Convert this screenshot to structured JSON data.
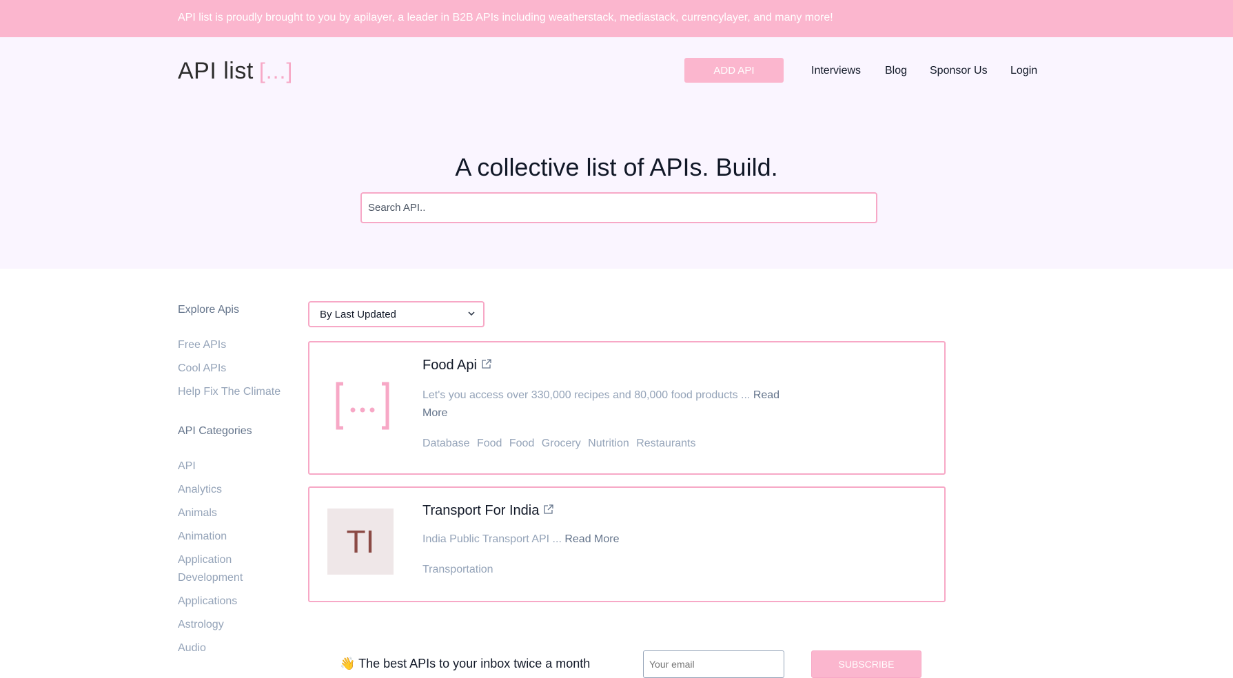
{
  "banner": {
    "text": "API list is proudly brought to you by apilayer, a leader in B2B APIs including weatherstack, mediastack, currencylayer, and many more!"
  },
  "header": {
    "logo_text": "API list",
    "logo_brackets": "[...]",
    "add_api_label": "ADD API",
    "nav": [
      "Interviews",
      "Blog",
      "Sponsor Us",
      "Login"
    ]
  },
  "hero": {
    "title": "A collective list of APIs. Build.",
    "search_placeholder": "Search API.."
  },
  "sidebar": {
    "explore_heading": "Explore Apis",
    "explore_items": [
      "Free APIs",
      "Cool APIs",
      "Help Fix The Climate"
    ],
    "categories_heading": "API Categories",
    "categories": [
      "API",
      "Analytics",
      "Animals",
      "Animation",
      "Application Development",
      "Applications",
      "Astrology",
      "Audio"
    ]
  },
  "sort": {
    "selected": "By Last Updated"
  },
  "cards": [
    {
      "title": "Food Api",
      "description": "Let's you access over 330,000 recipes and 80,000 food products ...",
      "read_more": "Read More",
      "tags": [
        "Database",
        "Food",
        "Food",
        "Grocery",
        "Nutrition",
        "Restaurants"
      ],
      "logo": "bracket-logo"
    },
    {
      "title": "Transport For India",
      "description": "India Public Transport API ...",
      "read_more": "Read More",
      "tags": [
        "Transportation"
      ],
      "initials": "TI"
    }
  ],
  "newsletter": {
    "text": "The best APIs to your inbox twice a month",
    "email_placeholder": "Your email",
    "subscribe_label": "SUBSCRIBE"
  },
  "colors": {
    "accent": "#fbb6ce",
    "hero_bg": "#faf5ff",
    "border": "#f7a8c6"
  }
}
